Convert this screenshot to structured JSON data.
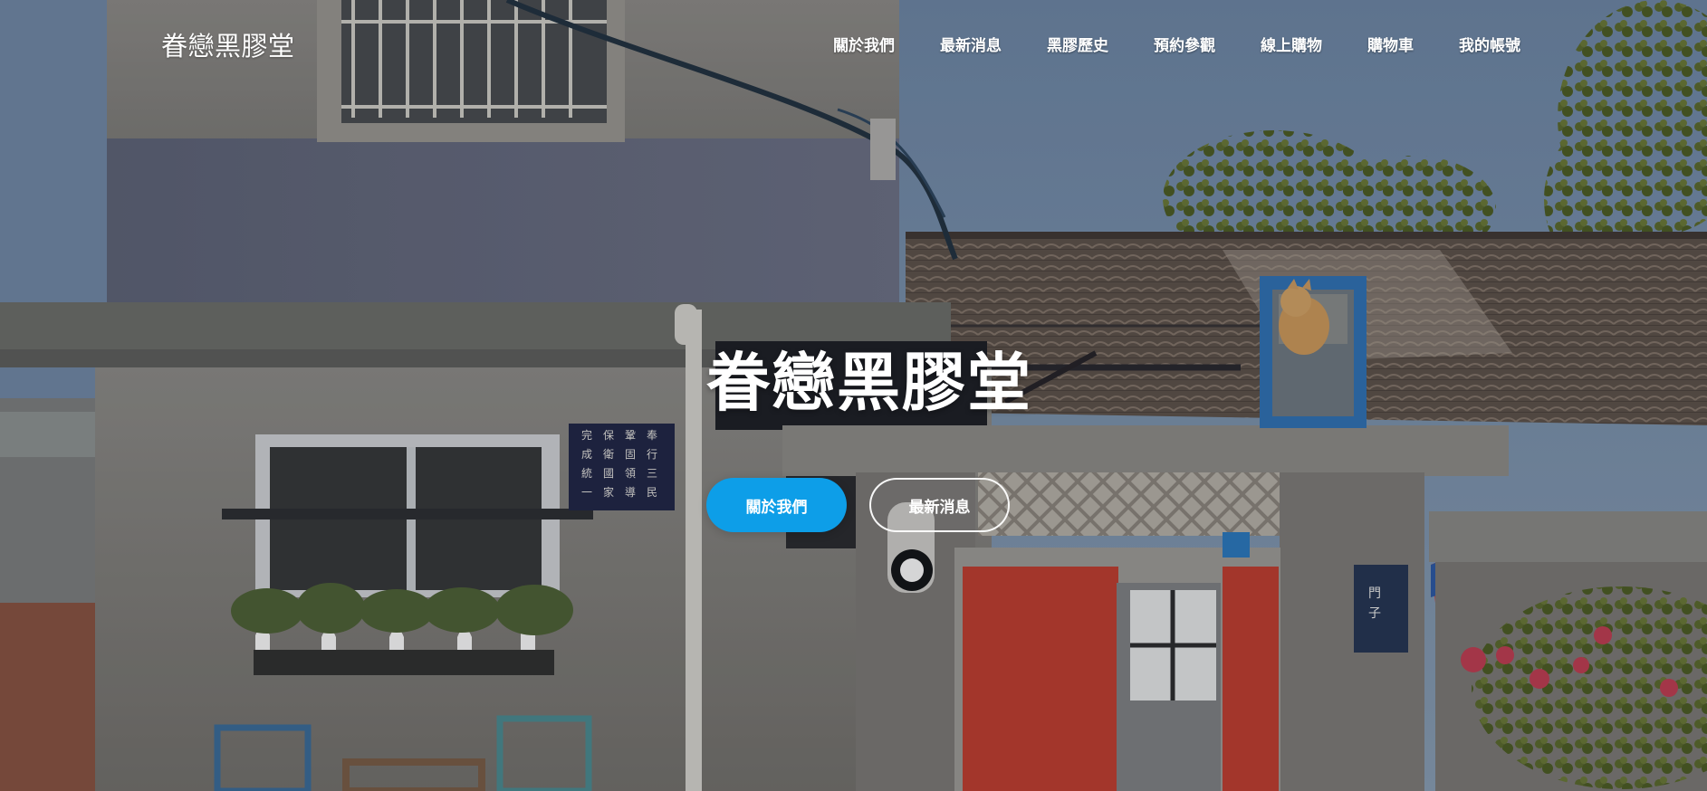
{
  "site": {
    "brand": "眷戀黑膠堂"
  },
  "navigation": {
    "items": [
      {
        "label": "關於我們"
      },
      {
        "label": "最新消息"
      },
      {
        "label": "黑膠歷史"
      },
      {
        "label": "預約參觀"
      },
      {
        "label": "線上購物"
      },
      {
        "label": "購物車"
      },
      {
        "label": "我的帳號"
      }
    ]
  },
  "hero": {
    "title": "眷戀黑膠堂",
    "primary_button": "關於我們",
    "secondary_button": "最新消息"
  },
  "colors": {
    "accent": "#0d9ee8",
    "text": "#ffffff"
  }
}
